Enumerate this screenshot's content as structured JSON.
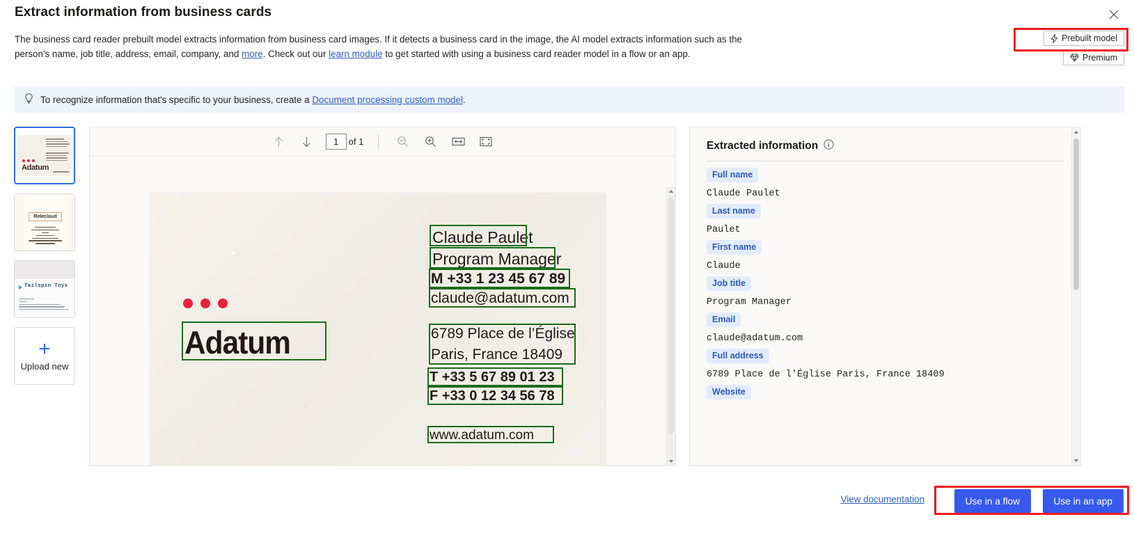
{
  "dialog": {
    "title": "Extract information from business cards",
    "close_icon": "close-icon"
  },
  "intro": {
    "part1": "The business card reader prebuilt model extracts information from business card images. If it detects a business card in the image, the AI model extracts information such as the person's name, job title, address, email, company, and ",
    "link_more": "more",
    "part2": ". Check out our ",
    "link_learn": "learn module",
    "part3": " to get started with using a business card reader model in a flow or an app."
  },
  "badges": [
    {
      "label": "Prebuilt model",
      "icon": "lightning-bolt-icon",
      "highlighted": true
    },
    {
      "label": "Premium",
      "icon": "diamond-icon",
      "highlighted": false
    }
  ],
  "infobar": {
    "icon": "lightbulb-icon",
    "text_before": "To recognize information that's specific to your business, create a ",
    "link": "Document processing custom model",
    "text_after": "."
  },
  "thumbnails": [
    {
      "name": "Adatum",
      "selected": true
    },
    {
      "name": "Relecloud",
      "selected": false
    },
    {
      "name": "Tailspin Toys",
      "selected": false
    }
  ],
  "upload": {
    "label": "Upload new",
    "icon": "plus-icon"
  },
  "viewer_toolbar": {
    "prev_icon": "arrow-up-icon",
    "next_icon": "arrow-down-icon",
    "page_value": "1",
    "page_of": "of 1",
    "zoom_out_icon": "zoom-out-icon",
    "zoom_in_icon": "zoom-in-icon",
    "fit_width_icon": "fit-width-icon",
    "fit_page_icon": "fit-page-icon"
  },
  "card": {
    "company": "Adatum",
    "lines": [
      {
        "key": "name",
        "text": "Claude Paulet"
      },
      {
        "key": "title",
        "text": "Program Manager"
      },
      {
        "key": "mobile",
        "text": "M +33 1 23 45 67 89"
      },
      {
        "key": "email",
        "text": "claude@adatum.com"
      },
      {
        "key": "addr1",
        "text": "6789 Place de l’Église"
      },
      {
        "key": "addr2",
        "text": "Paris, France 18409"
      },
      {
        "key": "tel",
        "text": "T +33 5 67 89 01 23"
      },
      {
        "key": "fax",
        "text": "F +33 0 12 34 56 78"
      },
      {
        "key": "website",
        "text": "www.adatum.com"
      }
    ],
    "box_color": "#1c6b1c",
    "dot_color": "#e8213f"
  },
  "extracted": {
    "heading": "Extracted information",
    "info_icon": "info-circle-icon",
    "fields": [
      {
        "label": "Full name",
        "value": "Claude Paulet"
      },
      {
        "label": "Last name",
        "value": "Paulet"
      },
      {
        "label": "First name",
        "value": "Claude"
      },
      {
        "label": "Job title",
        "value": "Program Manager"
      },
      {
        "label": "Email",
        "value": "claude@adatum.com"
      },
      {
        "label": "Full address",
        "value": "6789 Place de l'Église Paris, France 18409"
      },
      {
        "label": "Website",
        "value": ""
      }
    ]
  },
  "footer": {
    "doc_link": "View documentation",
    "use_in_flow": "Use in a flow",
    "use_in_app": "Use in an app",
    "primary_color": "#3959ec",
    "highlight_color": "#f01b1b"
  }
}
